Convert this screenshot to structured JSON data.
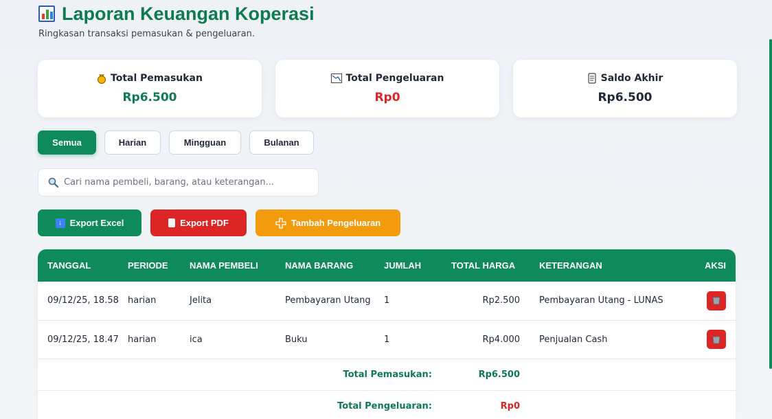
{
  "header": {
    "title": "Laporan Keuangan Koperasi",
    "subtitle": "Ringkasan transaksi pemasukan & pengeluaran."
  },
  "summary": {
    "income": {
      "label": "Total Pemasukan",
      "value": "Rp6.500",
      "icon": "money-bag-icon",
      "color": "#0f7a4f"
    },
    "expense": {
      "label": "Total Pengeluaran",
      "value": "Rp0",
      "icon": "chart-down-icon",
      "color": "#dc2626"
    },
    "balance": {
      "label": "Saldo Akhir",
      "value": "Rp6.500",
      "icon": "scroll-icon",
      "color": "#1f2937"
    }
  },
  "filters": [
    "Semua",
    "Harian",
    "Mingguan",
    "Bulanan"
  ],
  "search": {
    "placeholder": "Cari nama pembeli, barang, atau keterangan..."
  },
  "actions": {
    "export_excel": "Export Excel",
    "export_pdf": "Export PDF",
    "add_expense": "Tambah Pengeluaran"
  },
  "table": {
    "columns": [
      "TANGGAL",
      "PERIODE",
      "NAMA PEMBELI",
      "NAMA BARANG",
      "JUMLAH",
      "TOTAL HARGA",
      "KETERANGAN",
      "AKSI"
    ],
    "rows": [
      {
        "tanggal": "09/12/25, 18.58",
        "periode": "harian",
        "pembeli": "Jelita",
        "barang": "Pembayaran Utang",
        "jumlah": "1",
        "total": "Rp2.500",
        "keterangan": "Pembayaran Utang - LUNAS"
      },
      {
        "tanggal": "09/12/25, 18.47",
        "periode": "harian",
        "pembeli": "ica",
        "barang": "Buku",
        "jumlah": "1",
        "total": "Rp4.000",
        "keterangan": "Penjualan Cash"
      }
    ],
    "totals": {
      "income_label": "Total Pemasukan:",
      "income_value": "Rp6.500",
      "expense_label": "Total Pengeluaran:",
      "expense_value": "Rp0"
    }
  },
  "colors": {
    "primary": "#0f8a5a",
    "danger": "#dc2626",
    "warning": "#f29b0c"
  }
}
